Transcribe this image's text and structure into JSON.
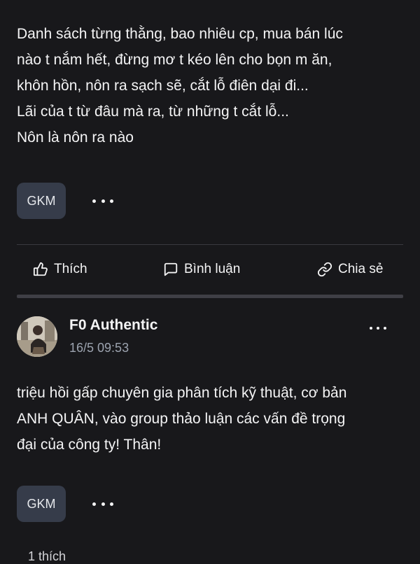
{
  "post1": {
    "lines": [
      "Danh sách từng thằng, bao nhiêu cp, mua bán lúc",
      "nào t nắm hết, đừng mơ t kéo lên cho bọn m ăn,",
      "khôn hồn, nôn ra sạch sẽ, cắt lỗ điên dại đi...",
      "Lãi của t từ đâu mà ra, từ những t cắt lỗ...",
      "Nôn là nôn ra nào"
    ],
    "tag": "GKM"
  },
  "actions": {
    "like": "Thích",
    "comment": "Bình luận",
    "share": "Chia sẻ"
  },
  "post2": {
    "author": "F0 Authentic",
    "time": "16/5 09:53",
    "lines": [
      "triệu hồi gấp chuyên gia phân tích kỹ thuật, cơ bản",
      "ANH QUÂN, vào group thảo luận các vấn đề trọng",
      "đại của công ty! Thân!"
    ],
    "tag": "GKM",
    "likes": "1 thích"
  },
  "icons": {
    "like": "thumbs-up-icon",
    "comment": "comment-icon",
    "share": "link-icon",
    "more": "more-horizontal-icon"
  }
}
